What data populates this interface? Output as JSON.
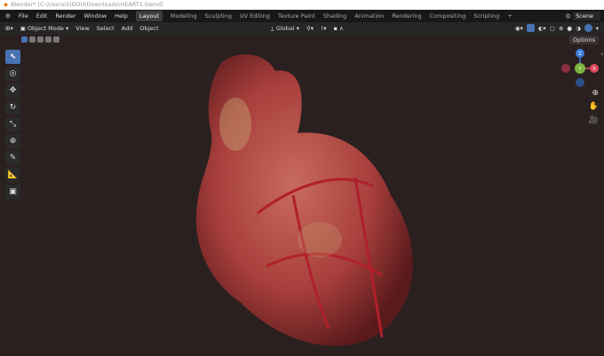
{
  "window_title": "Blender* [C:\\Users\\SIDOU\\Downloads\\HEART1.blend]",
  "menu": [
    "File",
    "Edit",
    "Render",
    "Window",
    "Help"
  ],
  "workspaces": [
    "Layout",
    "Modeling",
    "Sculpting",
    "UV Editing",
    "Texture Paint",
    "Shading",
    "Animation",
    "Rendering",
    "Compositing",
    "Scripting",
    "+"
  ],
  "scene": "Scene",
  "header": {
    "mode": "Object Mode",
    "items": [
      "View",
      "Select",
      "Add",
      "Object"
    ],
    "orientation": "Global",
    "options": "Options"
  },
  "gizmo": {
    "z": "Z",
    "x": "X",
    "y": "Y"
  },
  "colors": {
    "accent": "#4772b3",
    "x_axis": "#e04a5c",
    "y_axis": "#7ab33d",
    "z_axis": "#3f7ee0"
  }
}
